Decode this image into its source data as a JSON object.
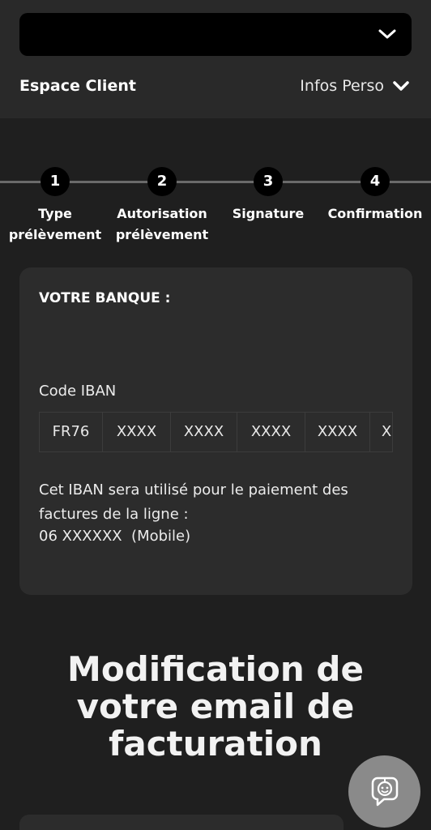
{
  "header": {
    "dropdown_value": "",
    "espace_client": "Espace Client",
    "infos_perso": "Infos Perso"
  },
  "stepper": {
    "steps": [
      {
        "number": "1",
        "label": "Type\nprélèvement"
      },
      {
        "number": "2",
        "label": "Autorisation\nprélèvement"
      },
      {
        "number": "3",
        "label": "Signature"
      },
      {
        "number": "4",
        "label": "Confirmation"
      }
    ]
  },
  "bank": {
    "title": "VOTRE BANQUE :",
    "iban_label": "Code IBAN",
    "iban_segments": [
      "FR76",
      "XXXX",
      "XXXX",
      "XXXX",
      "XXXX",
      "X"
    ],
    "description": "Cet IBAN sera utilisé pour le paiement des factures de la ligne :",
    "phone": "06 XXXXXX  (Mobile)"
  },
  "section": {
    "headline": "Modification de votre email de facturation"
  },
  "icons": {
    "dropdown_chevron": "chevron-down-icon",
    "infos_chevron": "chevron-down-icon",
    "chat": "chatbot-icon"
  },
  "colors": {
    "background": "#1f1f1f",
    "header": "#292929",
    "card": "#2c2c2c",
    "step_circle": "#000000",
    "chat_button": "#8a8a8a"
  }
}
